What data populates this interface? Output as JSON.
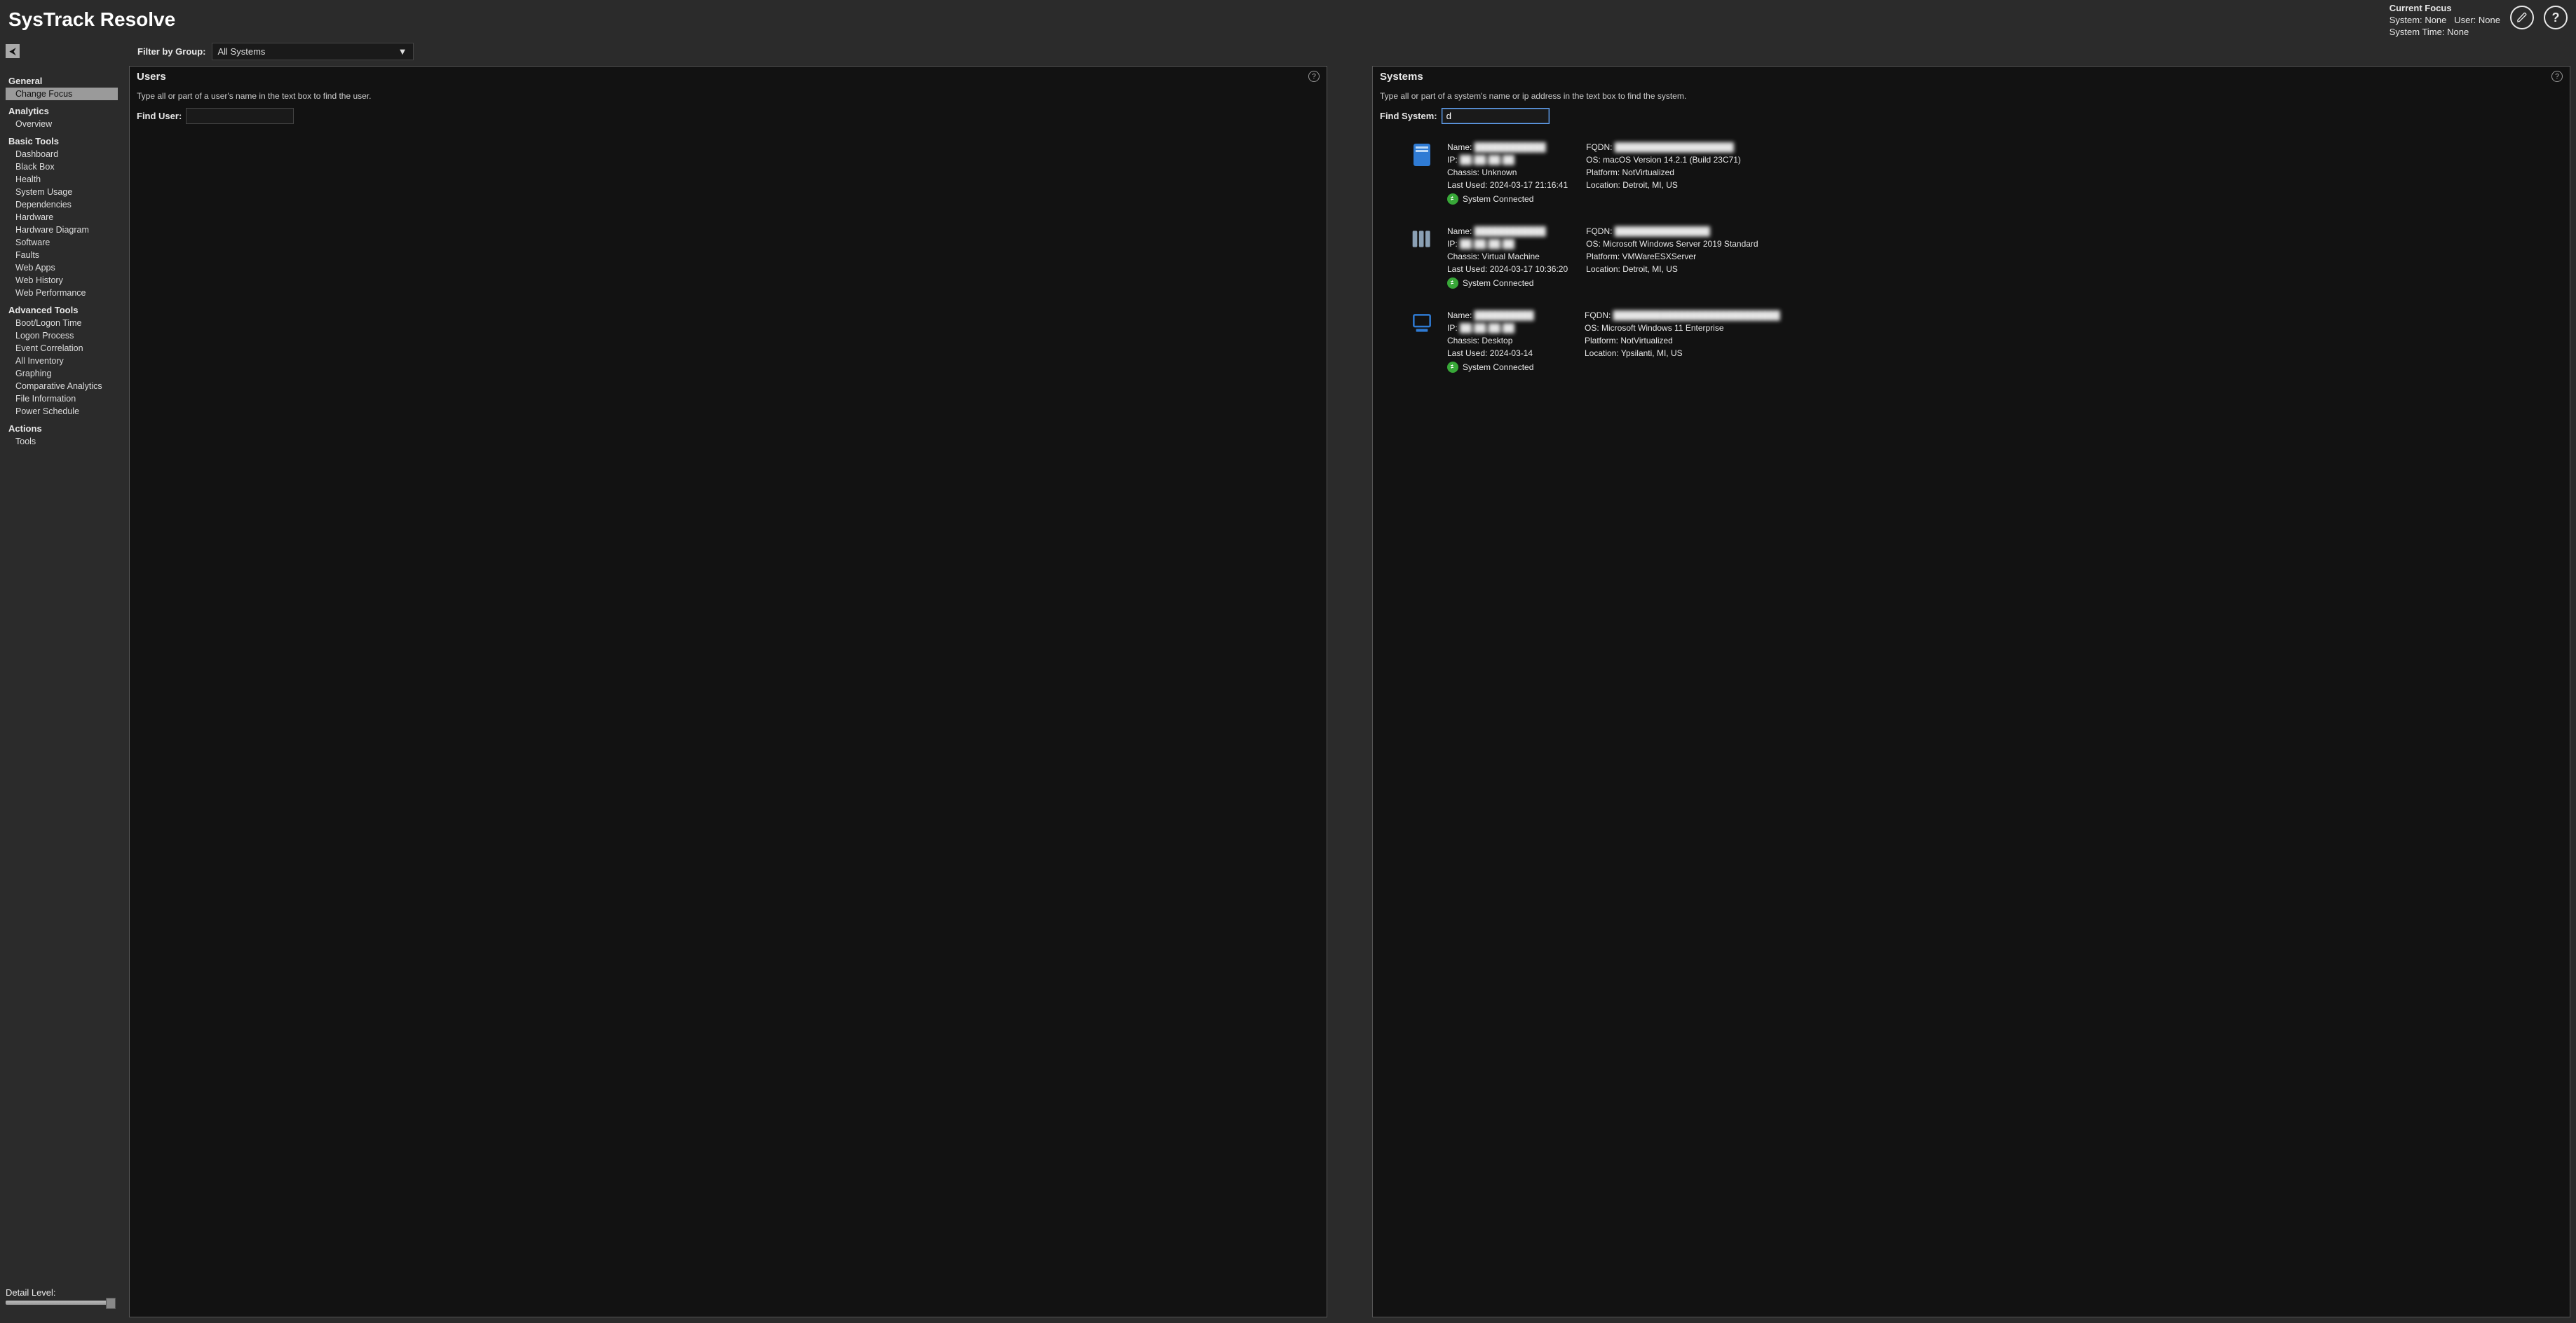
{
  "header": {
    "title": "SysTrack Resolve",
    "current_focus_title": "Current Focus",
    "system_label": "System:",
    "system_value": "None",
    "user_label": "User:",
    "user_value": "None",
    "system_time_label": "System Time:",
    "system_time_value": "None"
  },
  "filter": {
    "label": "Filter by Group:",
    "selected": "All Systems"
  },
  "sidebar": {
    "groups": [
      {
        "title": "General",
        "items": [
          {
            "label": "Change Focus",
            "active": true
          }
        ]
      },
      {
        "title": "Analytics",
        "items": [
          {
            "label": "Overview"
          }
        ]
      },
      {
        "title": "Basic Tools",
        "items": [
          {
            "label": "Dashboard"
          },
          {
            "label": "Black Box"
          },
          {
            "label": "Health"
          },
          {
            "label": "System Usage"
          },
          {
            "label": "Dependencies"
          },
          {
            "label": "Hardware"
          },
          {
            "label": "Hardware Diagram"
          },
          {
            "label": "Software"
          },
          {
            "label": "Faults"
          },
          {
            "label": "Web Apps"
          },
          {
            "label": "Web History"
          },
          {
            "label": "Web Performance"
          }
        ]
      },
      {
        "title": "Advanced Tools",
        "items": [
          {
            "label": "Boot/Logon Time"
          },
          {
            "label": "Logon Process"
          },
          {
            "label": "Event Correlation"
          },
          {
            "label": "All Inventory"
          },
          {
            "label": "Graphing"
          },
          {
            "label": "Comparative Analytics"
          },
          {
            "label": "File Information"
          },
          {
            "label": "Power Schedule"
          }
        ]
      },
      {
        "title": "Actions",
        "items": [
          {
            "label": "Tools"
          }
        ]
      }
    ],
    "detail_level_label": "Detail Level:"
  },
  "panels": {
    "users": {
      "title": "Users",
      "hint": "Type all or part of a user's name in the text box to find the user.",
      "find_label": "Find User:",
      "find_value": ""
    },
    "systems": {
      "title": "Systems",
      "hint": "Type all or part of a system's name or ip address in the text box to find the system.",
      "find_label": "Find System:",
      "find_value": "d",
      "results": [
        {
          "icon": "mac",
          "col1": {
            "name_label": "Name:",
            "name_value": "████████████",
            "ip_label": "IP:",
            "ip_value": "██.██.██.██",
            "chassis_label": "Chassis:",
            "chassis_value": "Unknown",
            "last_used_label": "Last Used:",
            "last_used_value": "2024-03-17 21:16:41",
            "status_text": "System Connected"
          },
          "col2": {
            "fqdn_label": "FQDN:",
            "fqdn_value": "████████████████████",
            "os_label": "OS:",
            "os_value": "macOS Version 14.2.1 (Build 23C71)",
            "platform_label": "Platform:",
            "platform_value": "NotVirtualized",
            "location_label": "Location:",
            "location_value": "Detroit, MI, US"
          }
        },
        {
          "icon": "server",
          "col1": {
            "name_label": "Name:",
            "name_value": "████████████",
            "ip_label": "IP:",
            "ip_value": "██.██.██.██",
            "chassis_label": "Chassis:",
            "chassis_value": "Virtual Machine",
            "last_used_label": "Last Used:",
            "last_used_value": "2024-03-17 10:36:20",
            "status_text": "System Connected"
          },
          "col2": {
            "fqdn_label": "FQDN:",
            "fqdn_value": "████████████████",
            "os_label": "OS:",
            "os_value": "Microsoft Windows Server 2019 Standard",
            "platform_label": "Platform:",
            "platform_value": "VMWareESXServer",
            "location_label": "Location:",
            "location_value": "Detroit, MI, US"
          }
        },
        {
          "icon": "desktop",
          "col1": {
            "name_label": "Name:",
            "name_value": "██████████",
            "ip_label": "IP:",
            "ip_value": "██.██.██.██",
            "chassis_label": "Chassis:",
            "chassis_value": "Desktop",
            "last_used_label": "Last Used:",
            "last_used_value": "2024-03-14",
            "status_text": "System Connected"
          },
          "col2": {
            "fqdn_label": "FQDN:",
            "fqdn_value": "████████████████████████████",
            "os_label": "OS:",
            "os_value": "Microsoft Windows 11 Enterprise",
            "platform_label": "Platform:",
            "platform_value": "NotVirtualized",
            "location_label": "Location:",
            "location_value": "Ypsilanti, MI, US"
          }
        }
      ]
    }
  }
}
